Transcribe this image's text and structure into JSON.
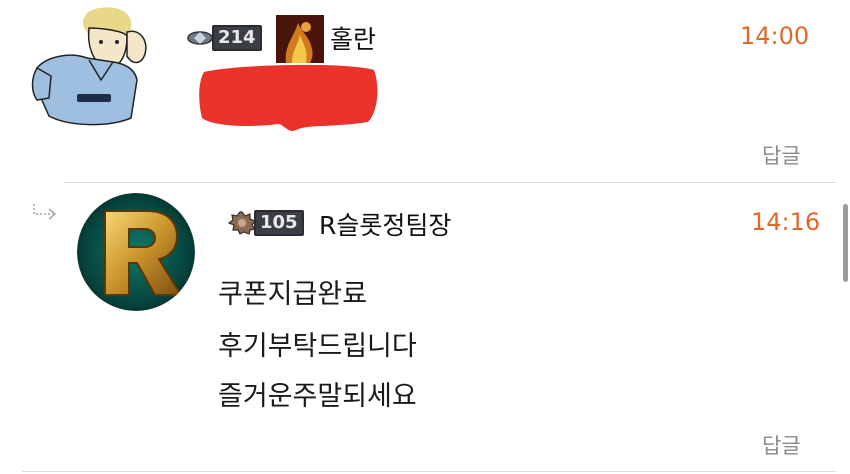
{
  "comments": [
    {
      "level": "214",
      "nickname": "홀란",
      "time": "14:00",
      "reply_label": "답글",
      "body_lines": [],
      "redacted": true,
      "avatar_icon": "cartoon-player-avatar-icon",
      "flair_icon": "fire-portrait-icon"
    },
    {
      "level": "105",
      "nickname": "R슬롯정팀장",
      "time": "14:16",
      "reply_label": "답글",
      "body_lines": [
        "쿠폰지급완료",
        "후기부탁드립니다",
        "즐거운주말되세요"
      ],
      "is_reply": true,
      "avatar_icon": "gold-letter-r-avatar-icon"
    }
  ],
  "colors": {
    "time": "#e0692a",
    "redaction": "#e8322a",
    "divider": "#dddddd",
    "reply_label": "#8a8a8a"
  }
}
